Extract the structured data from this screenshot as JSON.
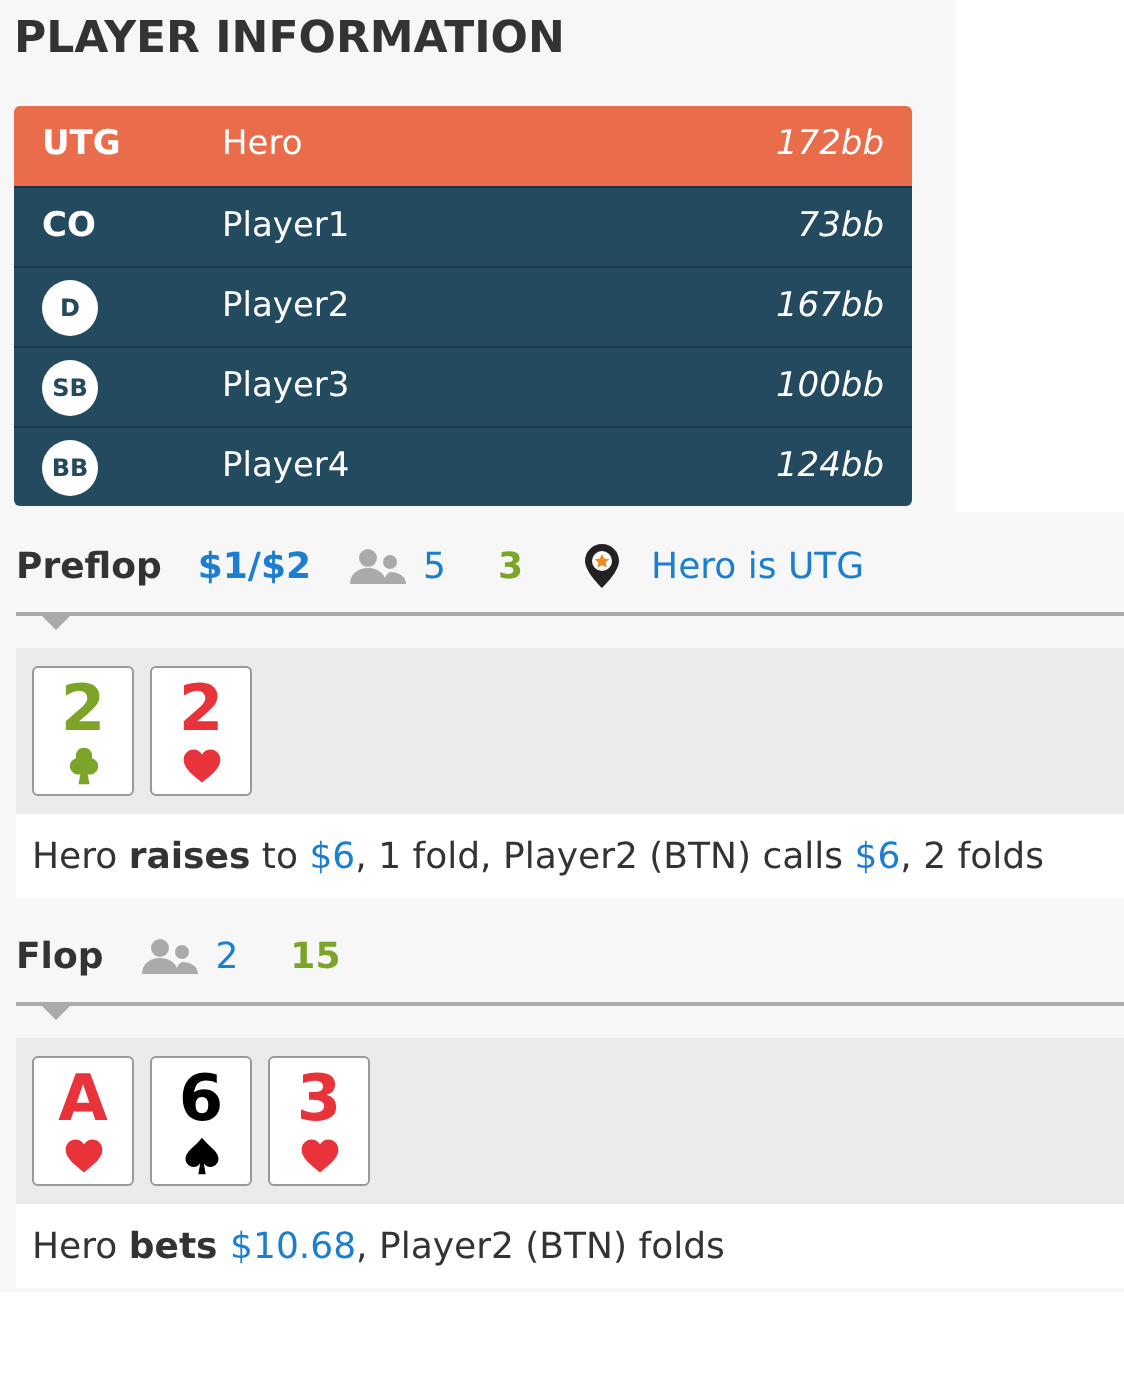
{
  "title": "PLAYER INFORMATION",
  "players": [
    {
      "position": "UTG",
      "kind": "text",
      "name": "Hero",
      "stack": "172bb",
      "selected": true
    },
    {
      "position": "CO",
      "kind": "text",
      "name": "Player1",
      "stack": "73bb",
      "selected": false
    },
    {
      "position": "D",
      "kind": "chip",
      "name": "Player2",
      "stack": "167bb",
      "selected": false
    },
    {
      "position": "SB",
      "kind": "chip",
      "name": "Player3",
      "stack": "100bb",
      "selected": false
    },
    {
      "position": "BB",
      "kind": "chip",
      "name": "Player4",
      "stack": "124bb",
      "selected": false
    }
  ],
  "streets": [
    {
      "name": "Preflop",
      "stakes": "$1/$2",
      "players": "5",
      "pot": "3",
      "hero_position": "Hero is UTG",
      "cards": [
        {
          "rank": "2",
          "kind": "clubs"
        },
        {
          "rank": "2",
          "kind": "hearts"
        }
      ],
      "action": [
        {
          "kind": "plain",
          "text": "Hero "
        },
        {
          "kind": "verb",
          "text": "raises"
        },
        {
          "kind": "plain",
          "text": " to "
        },
        {
          "kind": "amount",
          "text": "$6"
        },
        {
          "kind": "plain",
          "text": ", 1 fold, Player2 (BTN) calls "
        },
        {
          "kind": "amount",
          "text": "$6"
        },
        {
          "kind": "plain",
          "text": ", 2 folds"
        }
      ]
    },
    {
      "name": "Flop",
      "players": "2",
      "pot": "15",
      "cards": [
        {
          "rank": "A",
          "kind": "hearts"
        },
        {
          "rank": "6",
          "kind": "spades"
        },
        {
          "rank": "3",
          "kind": "hearts"
        }
      ],
      "action": [
        {
          "kind": "plain",
          "text": "Hero "
        },
        {
          "kind": "verb",
          "text": "bets "
        },
        {
          "kind": "amount",
          "text": "$10.68"
        },
        {
          "kind": "plain",
          "text": ", Player2 (BTN) folds"
        }
      ]
    }
  ]
}
